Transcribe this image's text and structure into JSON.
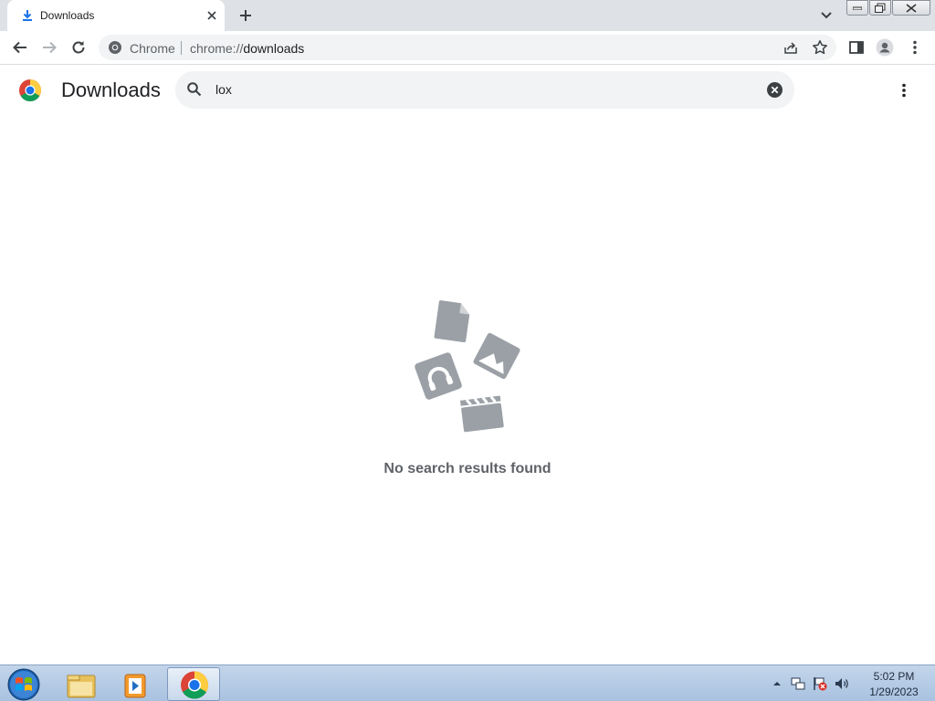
{
  "browser": {
    "tab": {
      "title": "Downloads"
    },
    "omnibox": {
      "site_label": "Chrome",
      "url_scheme": "chrome://",
      "url_path": "downloads"
    }
  },
  "page": {
    "title": "Downloads",
    "search": {
      "value": "lox"
    },
    "empty_message": "No search results found"
  },
  "taskbar": {
    "clock": {
      "time": "5:02 PM",
      "date": "1/29/2023"
    }
  },
  "colors": {
    "tabstrip": "#dee1e6",
    "omnibox": "#f1f3f4",
    "illustration": "#9aa0a6",
    "taskbar": "#b6cbe5"
  }
}
